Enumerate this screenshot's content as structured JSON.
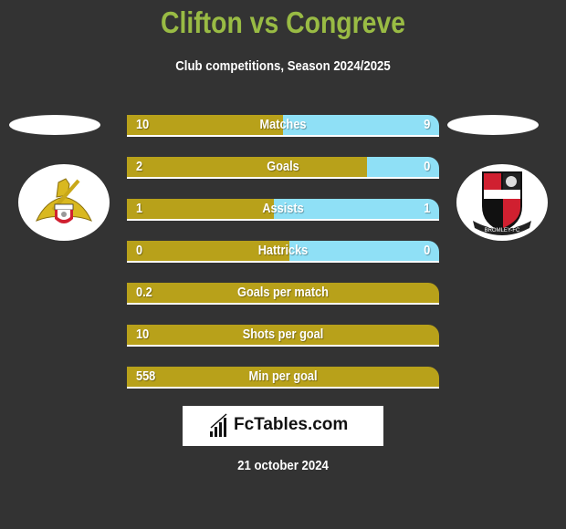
{
  "header": {
    "title": "Clifton vs Congreve",
    "subtitle": "Club competitions, Season 2024/2025"
  },
  "teams": {
    "left": {
      "logo": "doncaster-rovers-crest"
    },
    "right": {
      "logo": "bromley-fc-crest",
      "logo_text": "BROMLEY-FC"
    }
  },
  "colors": {
    "title": "#99bb44",
    "left_bar": "#b8a11a",
    "right_bar": "#8fe0f6",
    "background": "#333333"
  },
  "stats": [
    {
      "label": "Matches",
      "left": "10",
      "right": "9",
      "left_share": 0.5
    },
    {
      "label": "Goals",
      "left": "2",
      "right": "0",
      "left_share": 0.77
    },
    {
      "label": "Assists",
      "left": "1",
      "right": "1",
      "left_share": 0.47
    },
    {
      "label": "Hattricks",
      "left": "0",
      "right": "0",
      "left_share": 0.52
    },
    {
      "label": "Goals per match",
      "left": "0.2",
      "right": null,
      "left_share": 1
    },
    {
      "label": "Shots per goal",
      "left": "10",
      "right": null,
      "left_share": 1
    },
    {
      "label": "Min per goal",
      "left": "558",
      "right": null,
      "left_share": 1
    }
  ],
  "footer": {
    "brand": "FcTables.com",
    "date": "21 october 2024"
  }
}
